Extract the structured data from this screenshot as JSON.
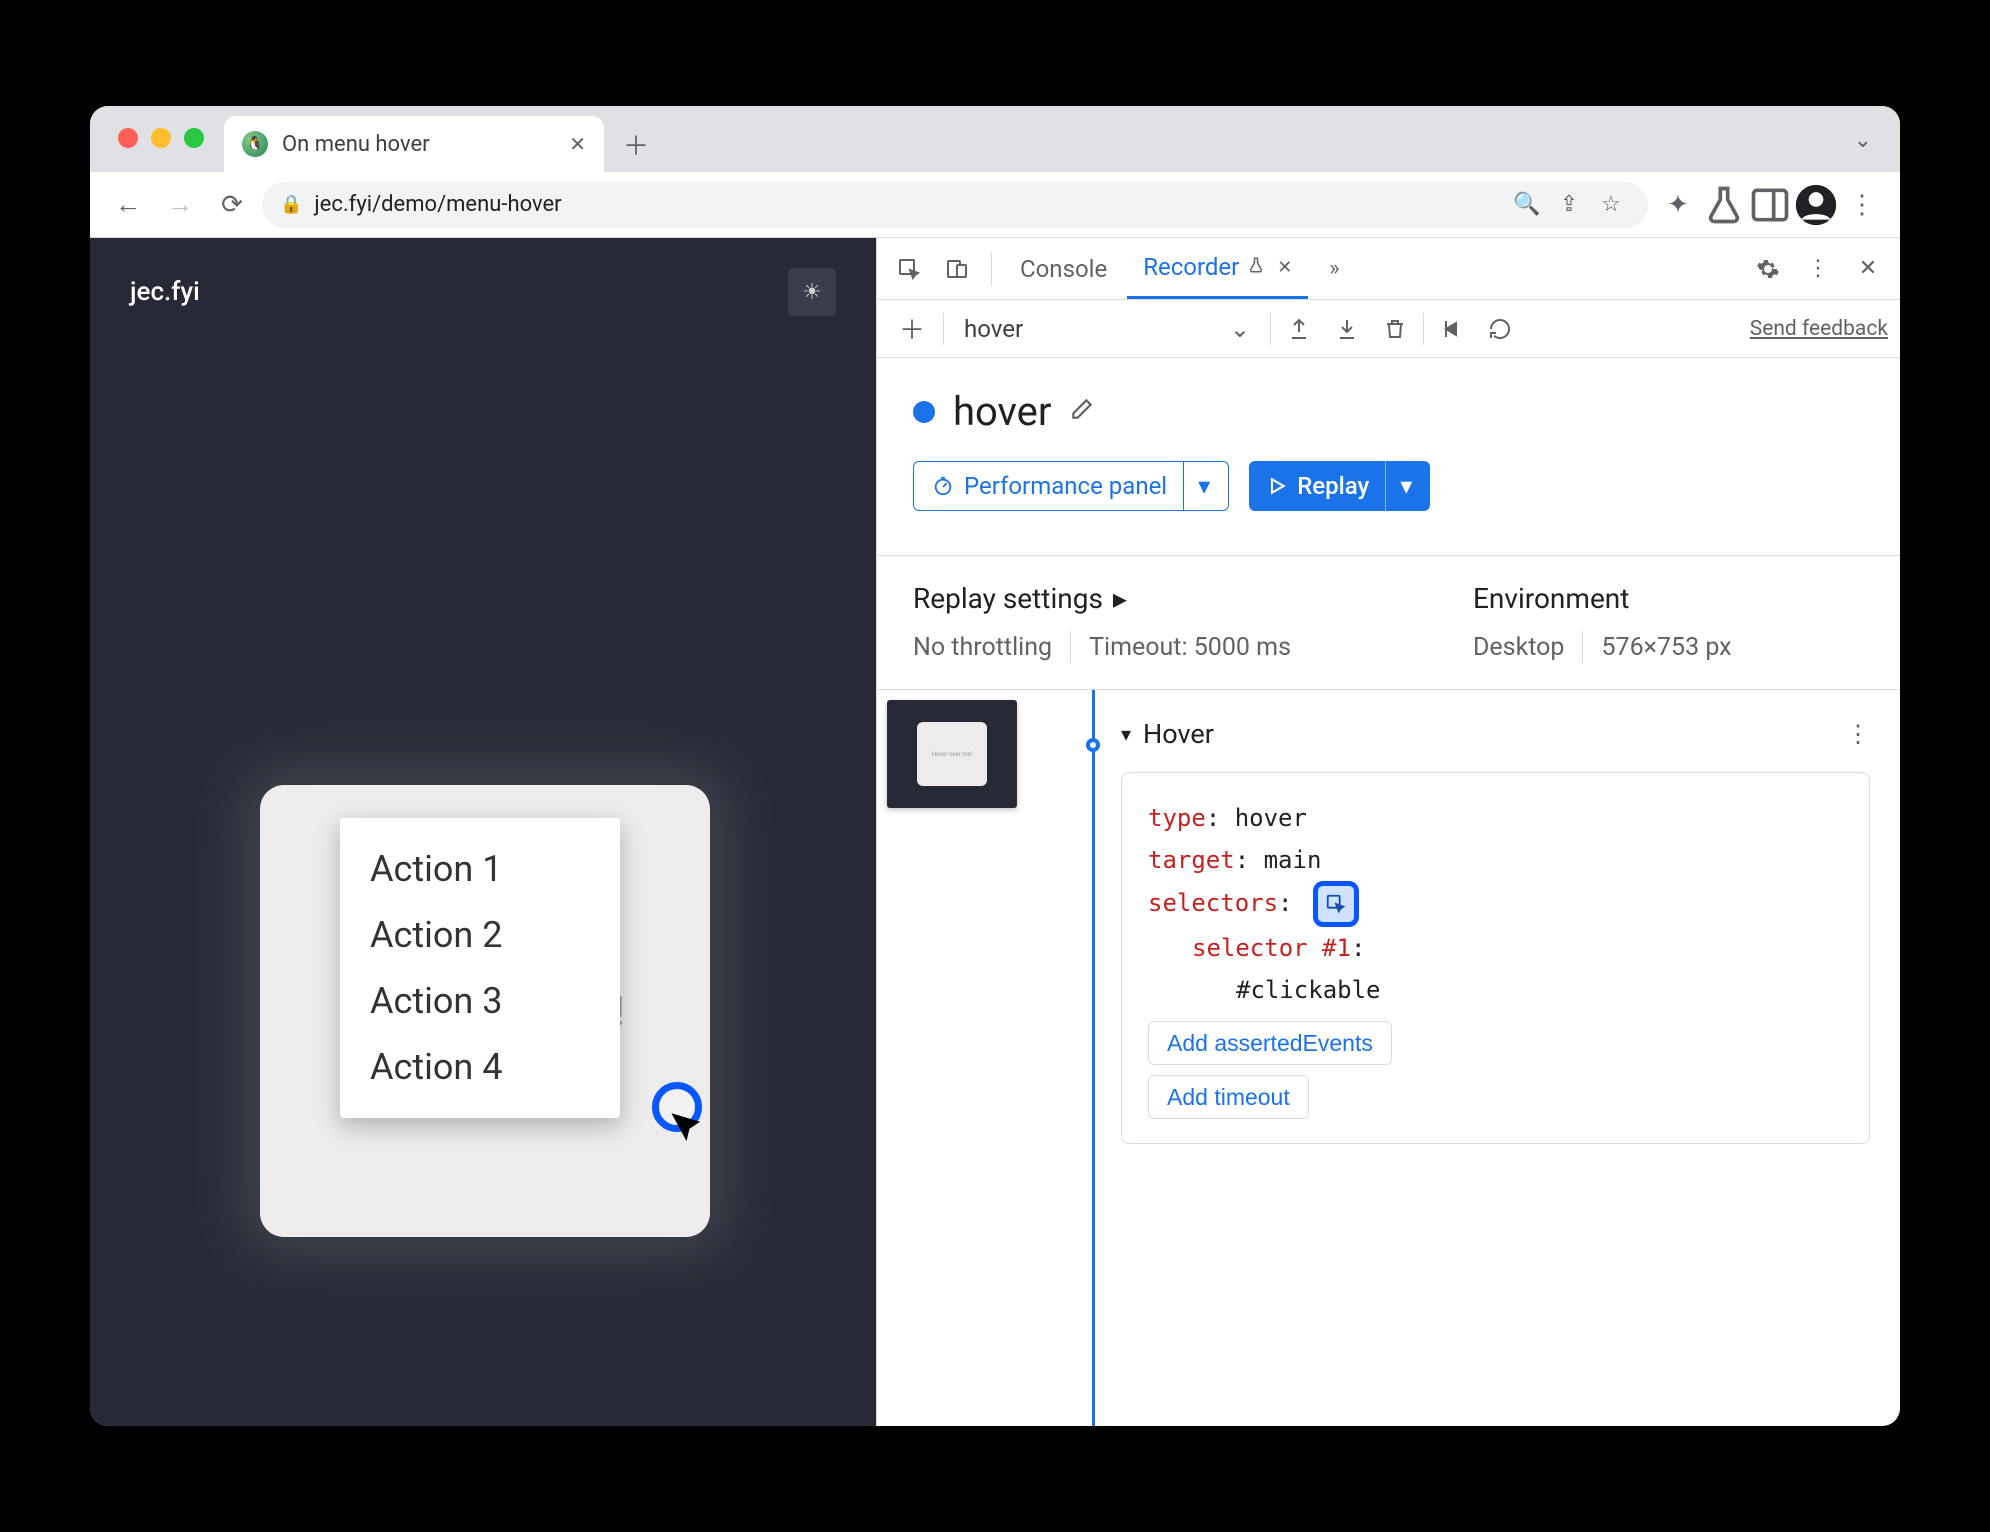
{
  "browser": {
    "tab_title": "On menu hover",
    "url": "jec.fyi/demo/menu-hover"
  },
  "page": {
    "site_title": "jec.fyi",
    "card_text": "Hover over me!",
    "menu_items": [
      "Action 1",
      "Action 2",
      "Action 3",
      "Action 4"
    ]
  },
  "devtools": {
    "tabs": {
      "console": "Console",
      "recorder": "Recorder"
    },
    "toolbar": {
      "recording_select": "hover",
      "feedback": "Send feedback"
    },
    "recording": {
      "title": "hover",
      "perf_btn": "Performance panel",
      "replay_btn": "Replay"
    },
    "settings": {
      "replay_hdr": "Replay settings",
      "throttle": "No throttling",
      "timeout": "Timeout: 5000 ms",
      "env_hdr": "Environment",
      "device": "Desktop",
      "viewport": "576×753 px"
    },
    "step": {
      "name": "Hover",
      "type_k": "type",
      "type_v": ": hover",
      "target_k": "target",
      "target_v": ": main",
      "selectors_k": "selectors",
      "selectors_colon": ":",
      "selnum_k": "selector #1",
      "selnum_colon": ":",
      "selval": "#clickable",
      "add_asserted": "Add assertedEvents",
      "add_timeout": "Add timeout"
    },
    "thumb_text": "Hover over me!"
  }
}
